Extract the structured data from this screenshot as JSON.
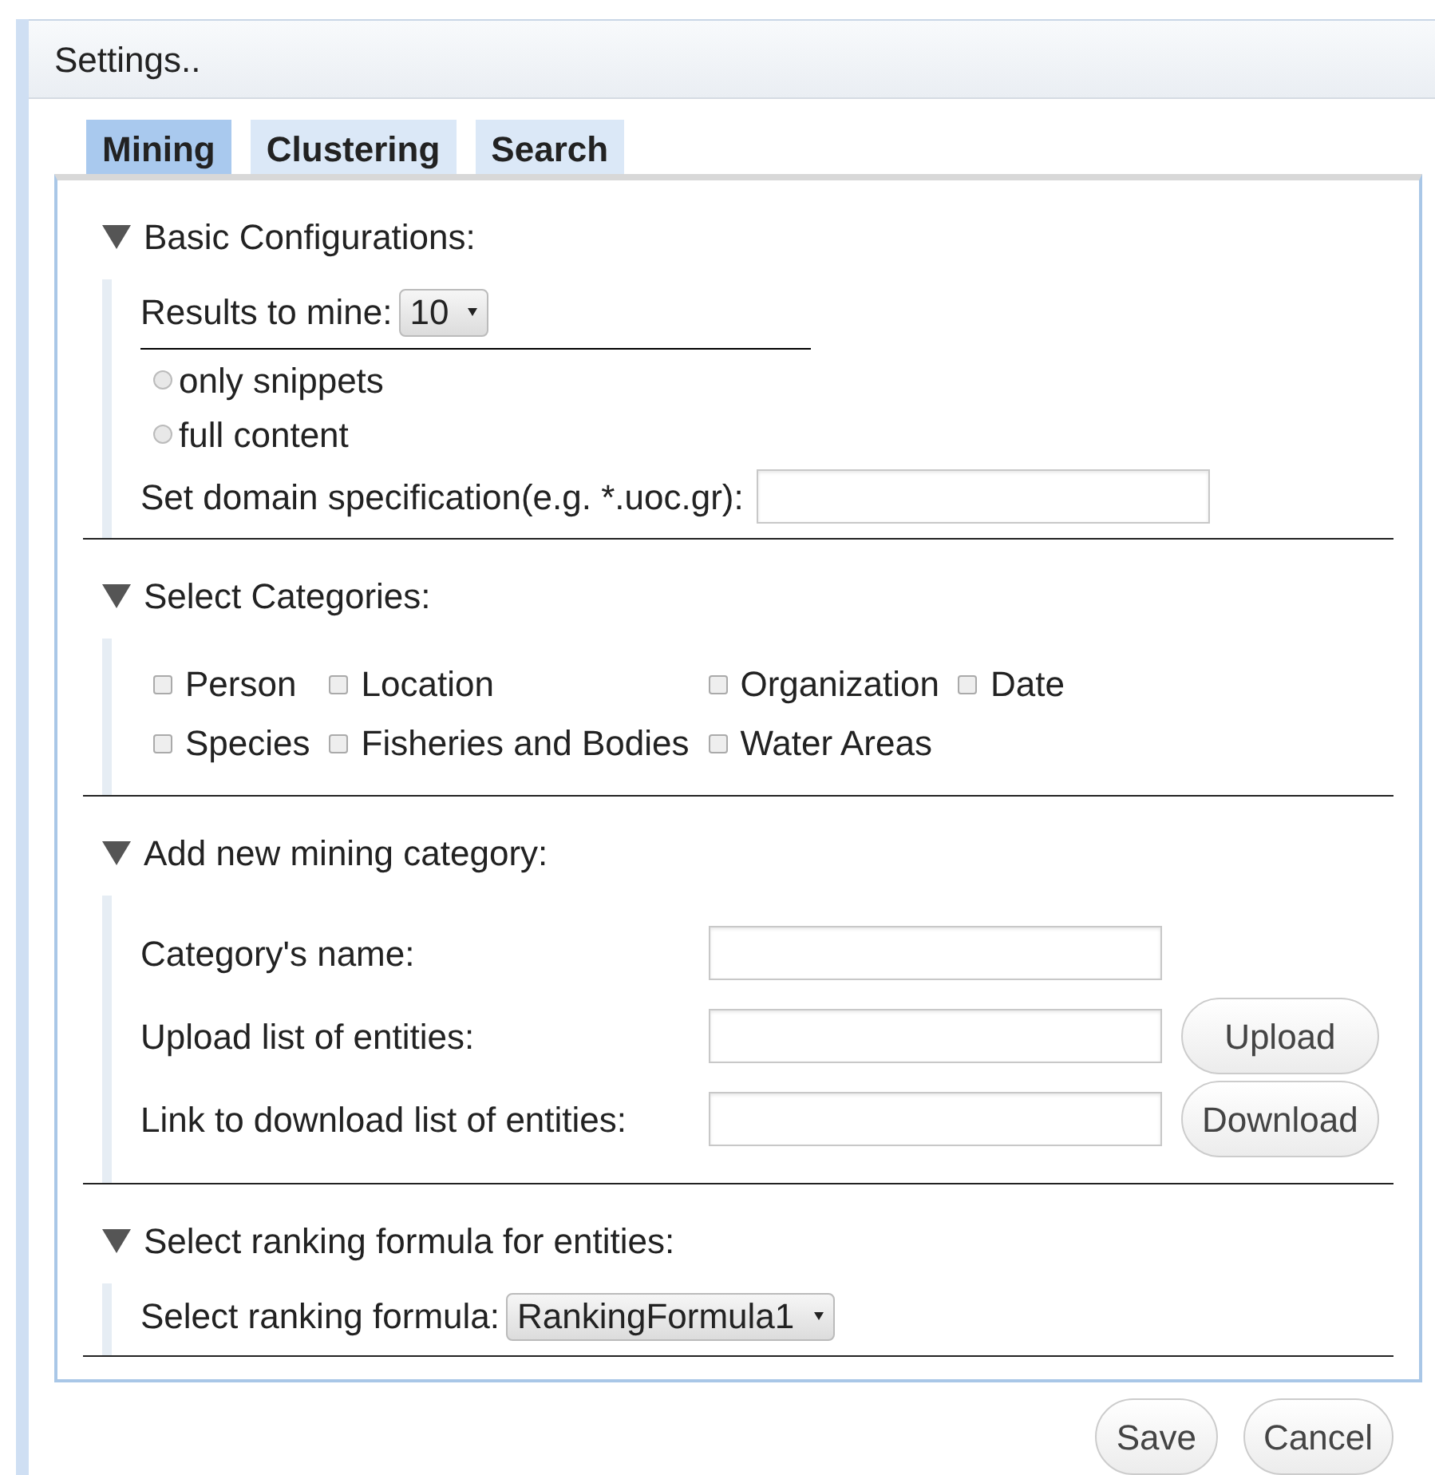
{
  "window": {
    "title": "Settings.."
  },
  "tabs": [
    {
      "label": "Mining",
      "selected": true
    },
    {
      "label": "Clustering",
      "selected": false
    },
    {
      "label": "Search",
      "selected": false
    }
  ],
  "sections": [
    {
      "title": "Basic Configurations:",
      "expanded": true,
      "rows": [
        {
          "kind": "select",
          "label": "Results to mine:",
          "value": "10"
        },
        {
          "kind": "rule"
        },
        {
          "kind": "radio",
          "label": "only snippets",
          "selected": false
        },
        {
          "kind": "radio",
          "label": "full content",
          "selected": false
        },
        {
          "kind": "field",
          "label": "Set domain specification(e.g. *.uoc.gr):"
        }
      ]
    },
    {
      "title": "Select Categories:",
      "expanded": true,
      "rows": [
        {
          "kind": "checkboxes",
          "items": [
            {
              "label": "Person",
              "checked": false
            },
            {
              "label": "Location",
              "checked": false
            },
            {
              "label": "Organization",
              "checked": false
            },
            {
              "label": "Date",
              "checked": false
            },
            {
              "label": "Species",
              "checked": false
            },
            {
              "label": "Fisheries and Bodies",
              "checked": false
            },
            {
              "label": "Water Areas",
              "checked": false
            }
          ]
        }
      ]
    },
    {
      "title": "Add new mining category:",
      "expanded": true,
      "rows": [
        {
          "kind": "field_grid",
          "items": [
            {
              "label": "Category's name:"
            },
            {
              "label": "Upload list of entities:",
              "button": "Upload"
            },
            {
              "label": "Link to download list of entities:",
              "button": "Download"
            }
          ]
        }
      ]
    },
    {
      "title": "Select ranking formula for entities:",
      "expanded": true,
      "rows": [
        {
          "kind": "select",
          "label": "Select ranking formula:",
          "value": "RankingFormula1"
        }
      ]
    }
  ],
  "buttons": [
    "Save",
    "Cancel"
  ]
}
